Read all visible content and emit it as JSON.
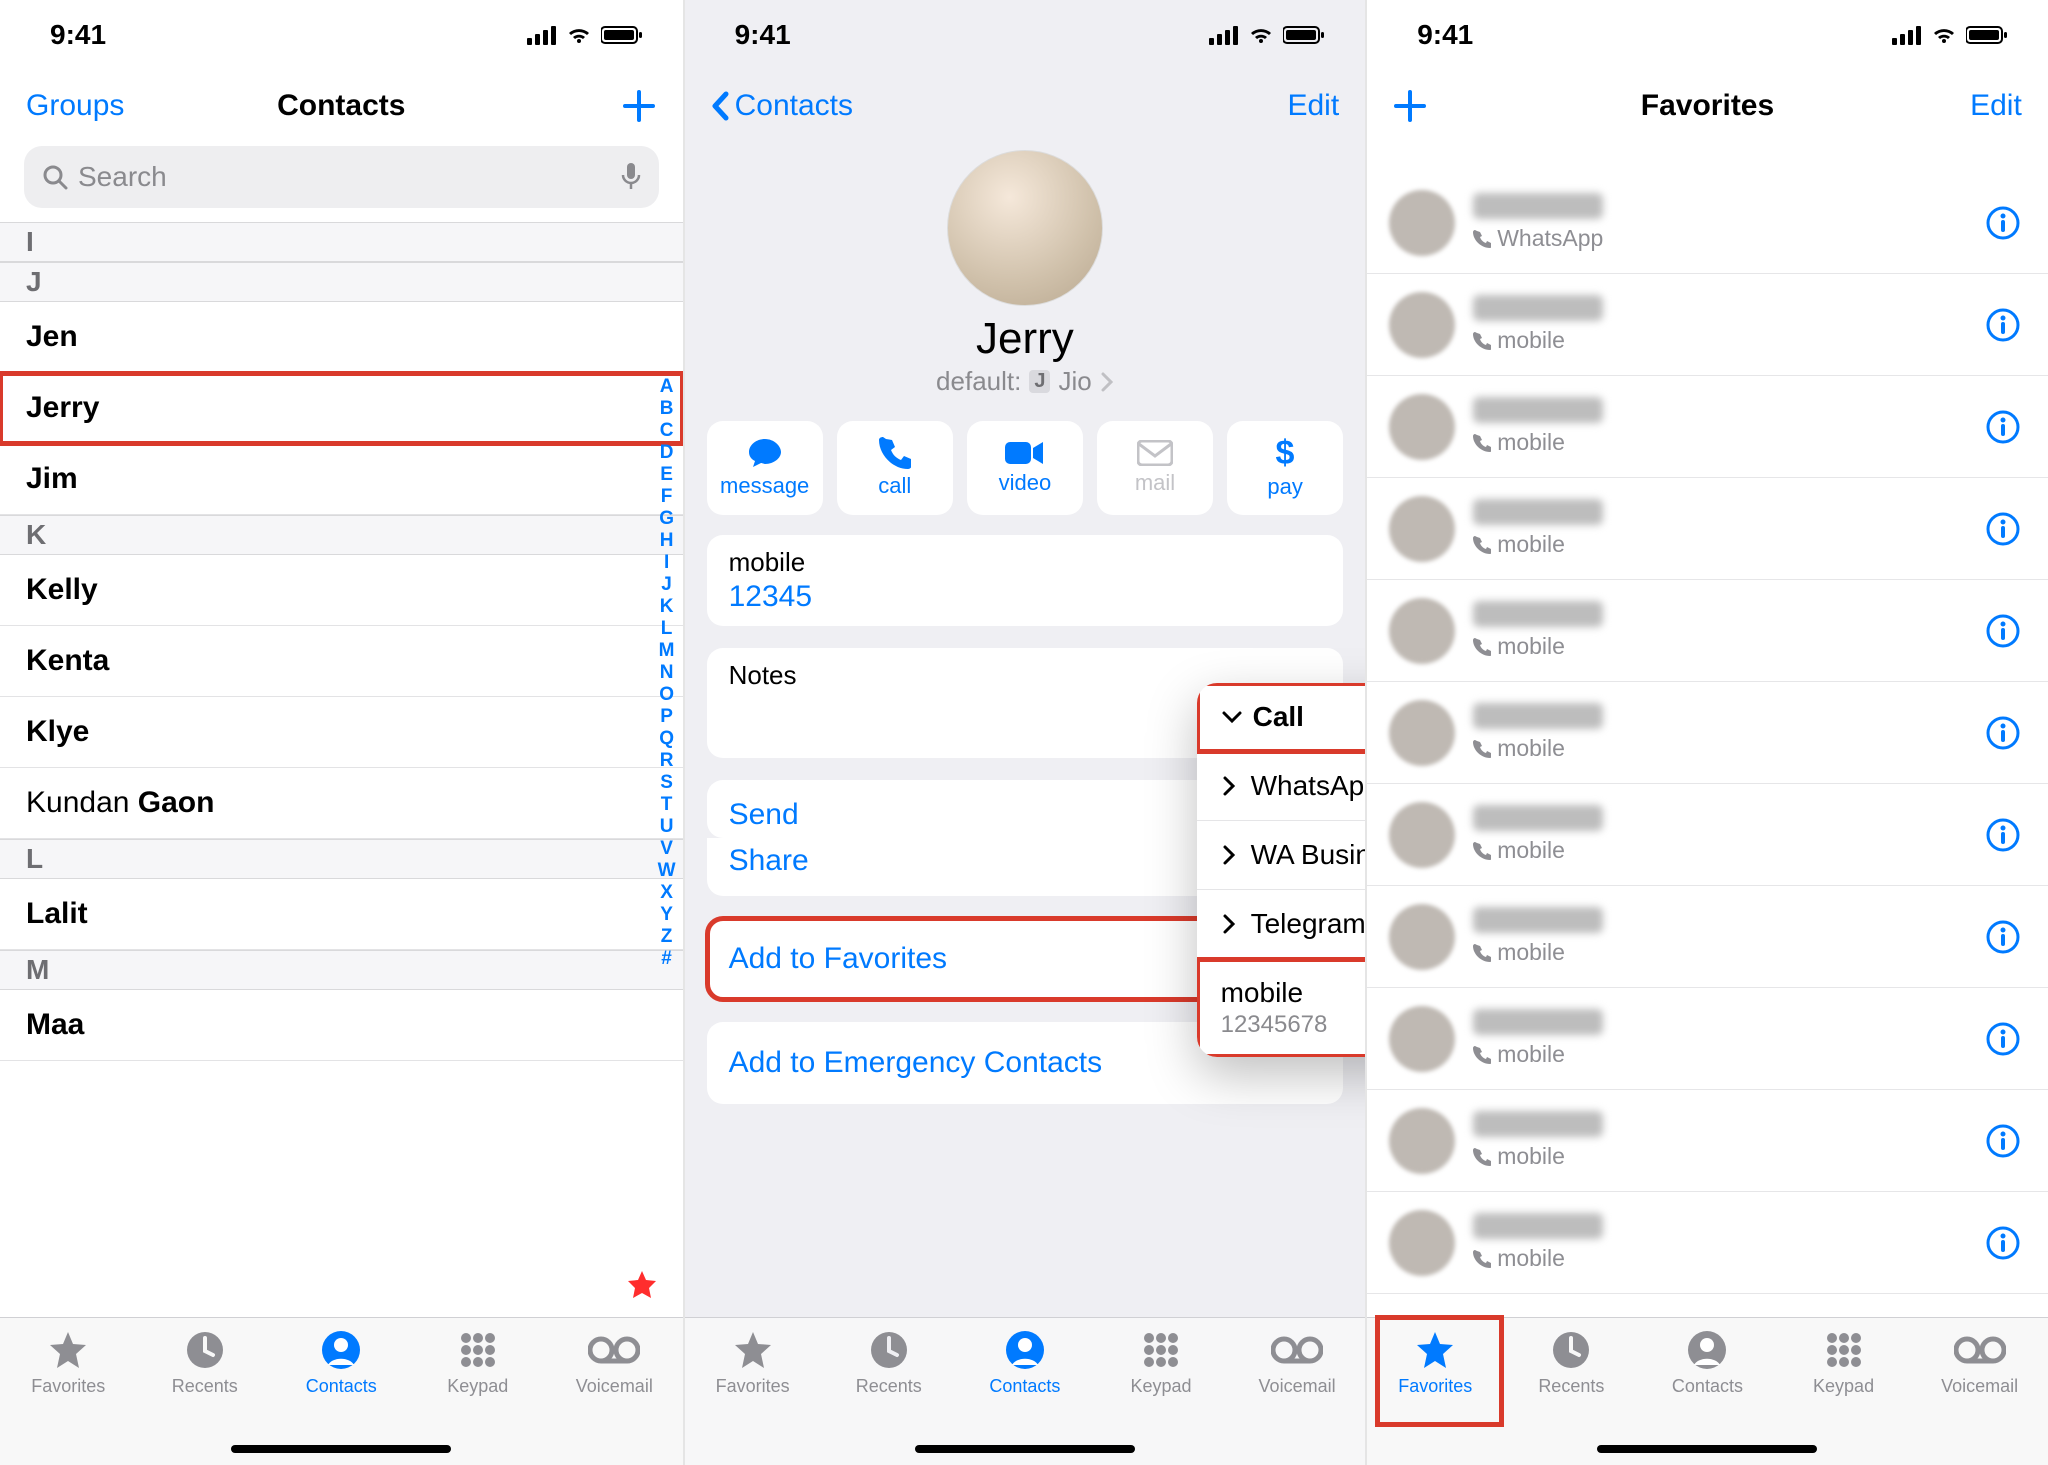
{
  "status": {
    "time": "9:41"
  },
  "screen1": {
    "groups": "Groups",
    "title": "Contacts",
    "search_ph": "Search",
    "sections": [
      {
        "letter": "I",
        "rows": []
      },
      {
        "letter": "J",
        "rows": [
          {
            "first": "",
            "last": "Jen",
            "hi": false
          },
          {
            "first": "",
            "last": "Jerry",
            "hi": true
          },
          {
            "first": "",
            "last": "Jim",
            "hi": false
          }
        ]
      },
      {
        "letter": "K",
        "rows": [
          {
            "first": "",
            "last": "Kelly"
          },
          {
            "first": "",
            "last": "Kenta"
          },
          {
            "first": "",
            "last": "Klye"
          },
          {
            "first": "Kundan ",
            "last": "Gaon"
          }
        ]
      },
      {
        "letter": "L",
        "rows": [
          {
            "first": "",
            "last": "Lalit"
          }
        ]
      },
      {
        "letter": "M",
        "rows": [
          {
            "first": "",
            "last": "Maa"
          }
        ]
      }
    ],
    "az": [
      "A",
      "B",
      "C",
      "D",
      "E",
      "F",
      "G",
      "H",
      "I",
      "J",
      "K",
      "L",
      "M",
      "N",
      "O",
      "P",
      "Q",
      "R",
      "S",
      "T",
      "U",
      "V",
      "W",
      "X",
      "Y",
      "Z",
      "#"
    ]
  },
  "screen2": {
    "back": "Contacts",
    "edit": "Edit",
    "name": "Jerry",
    "default_label": "default:",
    "sim": "Jio",
    "actions": {
      "message": "message",
      "call": "call",
      "video": "video",
      "mail": "mail",
      "pay": "pay"
    },
    "phone_label": "mobile",
    "phone_value": "12345",
    "notes_label": "Notes",
    "send": "Send",
    "share": "Share",
    "add_fav": "Add to Favorites",
    "add_emer": "Add to Emergency Contacts",
    "popup": {
      "head": "Call",
      "items": [
        "WhatsApp",
        "WA Business",
        "Telegram"
      ],
      "mobile_label": "mobile",
      "mobile_num": "12345678"
    }
  },
  "screen3": {
    "title": "Favorites",
    "edit": "Edit",
    "rows": [
      {
        "sub": "WhatsApp"
      },
      {
        "sub": "mobile"
      },
      {
        "sub": "mobile"
      },
      {
        "sub": "mobile"
      },
      {
        "sub": "mobile"
      },
      {
        "sub": "mobile"
      },
      {
        "sub": "mobile"
      },
      {
        "sub": "mobile"
      },
      {
        "sub": "mobile"
      },
      {
        "sub": "mobile"
      },
      {
        "sub": "mobile"
      }
    ]
  },
  "tabs": {
    "favorites": "Favorites",
    "recents": "Recents",
    "contacts": "Contacts",
    "keypad": "Keypad",
    "voicemail": "Voicemail"
  }
}
